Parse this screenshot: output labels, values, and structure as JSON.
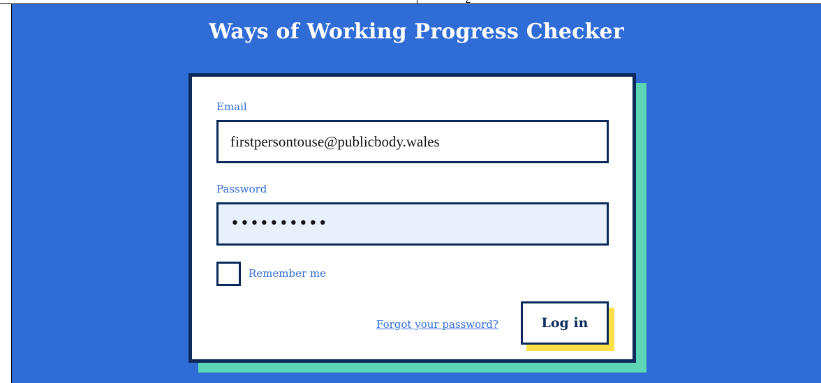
{
  "page": {
    "title": "Ways of Working Progress Checker"
  },
  "login_form": {
    "email_label": "Email",
    "email_value": "firstpersontouse@publicbody.wales",
    "password_label": "Password",
    "password_value_masked": "••••••••••",
    "remember_label": "Remember me",
    "remember_checked": false,
    "forgot_link": "Forgot your password?",
    "submit_label": "Log in"
  },
  "colors": {
    "background": "#2f6cd6",
    "card_border": "#0b2a5b",
    "accent_green": "#5cd6b5",
    "accent_yellow": "#ffe048",
    "label_text": "#2f6cd6",
    "password_fill": "#e8f0fc"
  }
}
